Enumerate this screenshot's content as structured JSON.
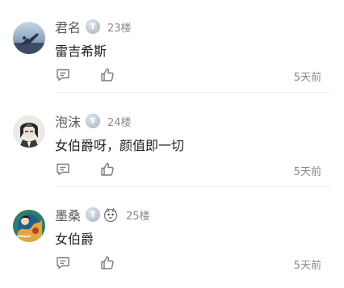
{
  "comments": [
    {
      "username": "君名",
      "level_badge": "T",
      "floor": "23楼",
      "text": "雷吉希斯",
      "time": "5天前",
      "has_deco_badge": false
    },
    {
      "username": "泡沫",
      "level_badge": "T",
      "floor": "24楼",
      "text": "女伯爵呀，颜值即一切",
      "time": "5天前",
      "has_deco_badge": false
    },
    {
      "username": "墨桑",
      "level_badge": "T",
      "floor": "25楼",
      "text": "女伯爵",
      "time": "5天前",
      "has_deco_badge": true
    }
  ],
  "icons": {
    "reply": "comment-icon",
    "like": "thumbs-up-icon"
  },
  "colors": {
    "username": "#5a5a5a",
    "meta": "#8a8a8a",
    "text": "#1f1f1f",
    "divider": "#efefef"
  }
}
